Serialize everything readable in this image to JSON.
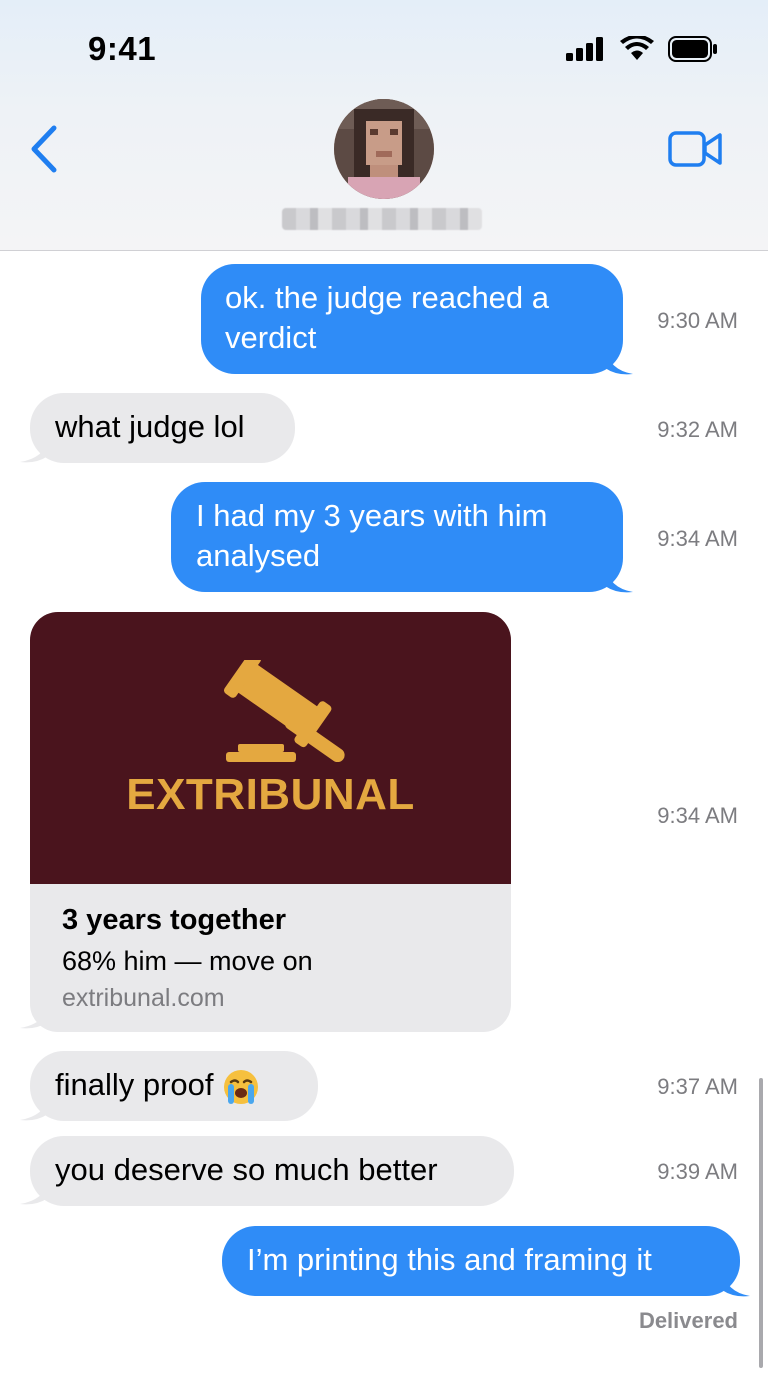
{
  "status_bar": {
    "time": "9:41"
  },
  "colors": {
    "sent_bubble": "#2f8cf7",
    "received_bubble": "#e9e9eb",
    "accent": "#2f8cf7",
    "card_bg": "#4a141d",
    "brand": "#e4a840"
  },
  "header": {
    "back_icon": "chevron-left-icon",
    "video_icon": "video-camera-icon",
    "avatar": "blurred contact photo",
    "contact_name_blurred": true
  },
  "messages": [
    {
      "text": "ok. the judge reached a verdict",
      "line1": "ok. the judge reached a",
      "line2": "verdict",
      "time": "9:30 AM",
      "sender": "me"
    },
    {
      "text": "what judge lol",
      "time": "9:32 AM",
      "sender": "them"
    },
    {
      "text": "I had my 3 years with him analysed",
      "line1": "I had my 3 years with him",
      "line2": "analysed",
      "time": "9:34 AM",
      "sender": "me"
    },
    {
      "type": "link-card",
      "time": "9:34 AM",
      "sender": "them",
      "brand": "EXTRIBUNAL",
      "title": "3 years together",
      "subtitle": "68% him — move on",
      "url": "extribunal.com"
    },
    {
      "text": "finally proof",
      "emoji": "😭",
      "time": "9:37 AM",
      "sender": "them"
    },
    {
      "text": "you deserve so much better",
      "time": "9:39 AM",
      "sender": "them"
    },
    {
      "text": "I’m printing this and framing it",
      "sender": "me",
      "status": "Delivered"
    }
  ]
}
